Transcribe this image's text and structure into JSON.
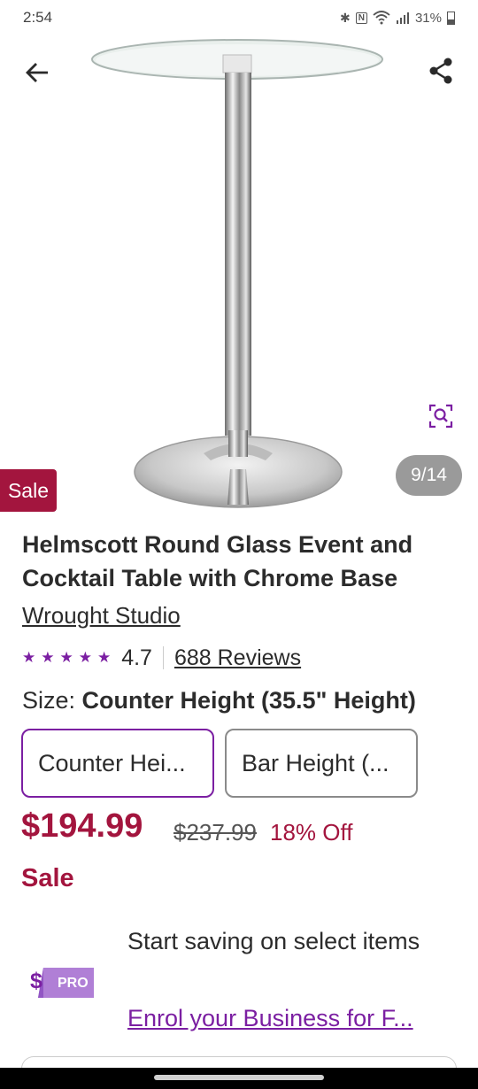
{
  "status_bar": {
    "time": "2:54",
    "battery": "31%",
    "icons": [
      "bluetooth-icon",
      "nfc-icon",
      "wifi-icon",
      "signal-icon",
      "battery-icon"
    ]
  },
  "gallery": {
    "counter": "9/14",
    "sale_tag": "Sale"
  },
  "product": {
    "title": "Helmscott Round Glass Event and Cocktail Table with Chrome Base",
    "brand": "Wrought Studio",
    "rating": "4.7",
    "stars": 4.7,
    "reviews": "688 Reviews"
  },
  "size": {
    "label": "Size:",
    "selected": "Counter Height (35.5\" Height)",
    "options": [
      "Counter Hei...",
      "Bar Height (..."
    ]
  },
  "pricing": {
    "price": "$194.99",
    "original": "$237.99",
    "discount": "18% Off",
    "sale": "Sale"
  },
  "pro_banner": {
    "logo_dollar": "$",
    "logo_text": "PRO",
    "text": "Start saving on select items",
    "link": "Enrol your Business for F..."
  },
  "colors": {
    "accent_purple": "#7b1fa2",
    "sale_red": "#a3153e"
  }
}
